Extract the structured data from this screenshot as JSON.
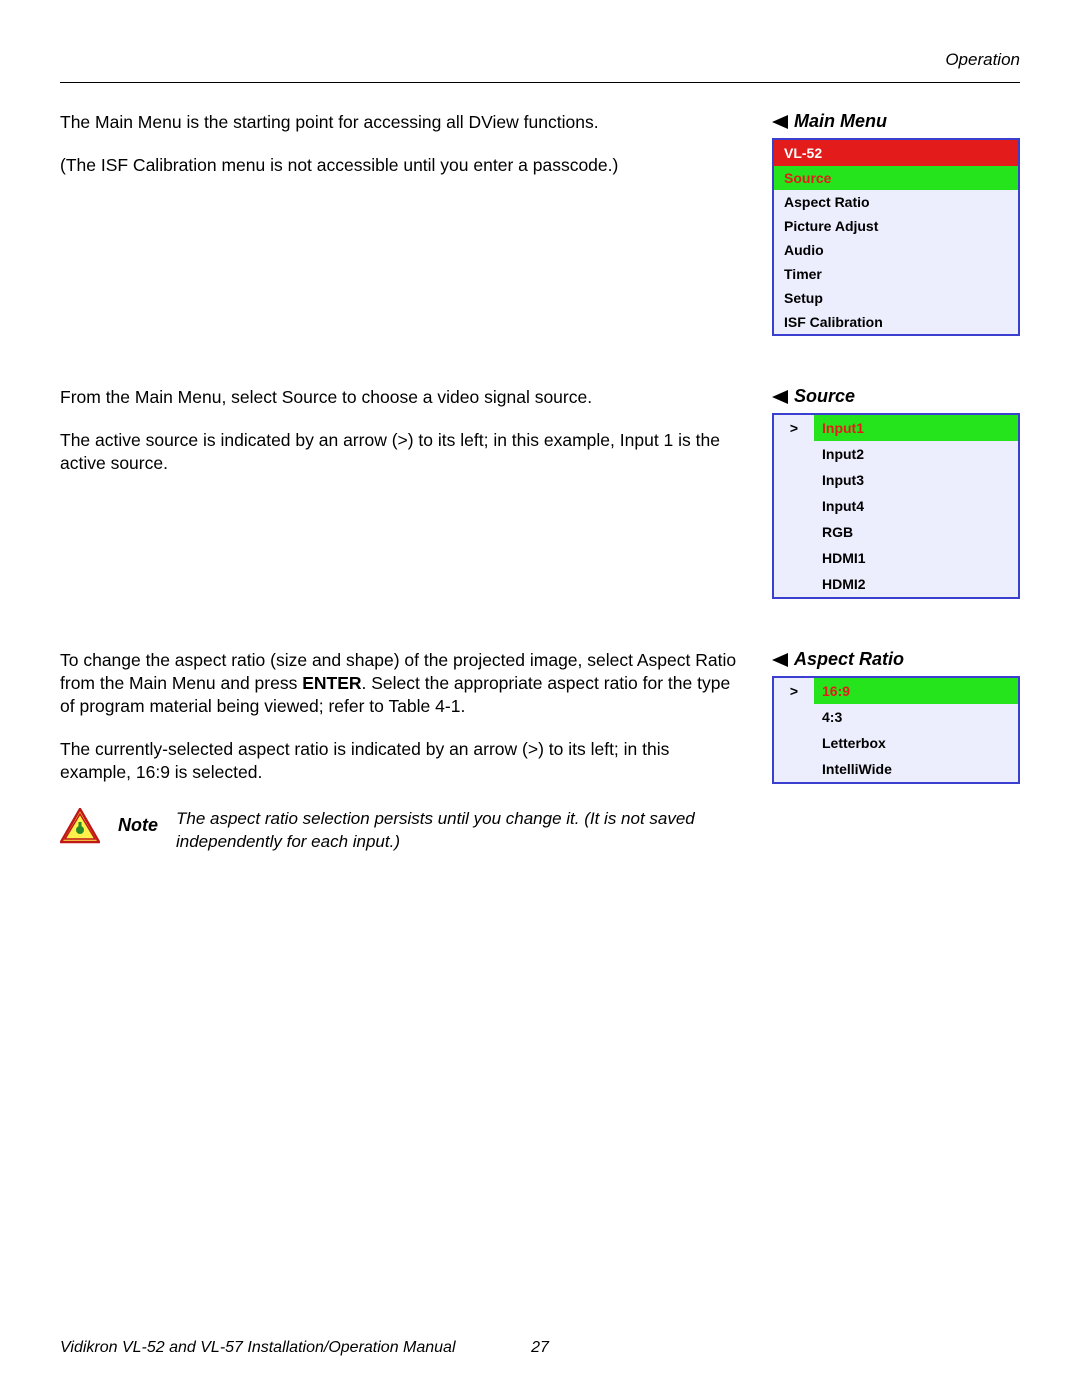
{
  "header": {
    "section_label": "Operation"
  },
  "main_menu_section": {
    "p1": "The Main Menu is the starting point for accessing all DView functions.",
    "p2": "(The ISF Calibration menu is not accessible until you enter a passcode.)",
    "heading": "Main Menu",
    "box_title": "VL-52",
    "items": [
      "Source",
      "Aspect Ratio",
      "Picture Adjust",
      "Audio",
      "Timer",
      "Setup",
      "ISF Calibration"
    ],
    "selected_index": 0
  },
  "source_section": {
    "p1": "From the Main Menu, select Source to choose a video signal source.",
    "p2": "The active source is indicated by an arrow (>) to its left; in this example, Input 1 is the active source.",
    "heading": "Source",
    "items": [
      "Input1",
      "Input2",
      "Input3",
      "Input4",
      "RGB",
      "HDMI1",
      "HDMI2"
    ],
    "selected_index": 0,
    "arrow_glyph": ">"
  },
  "aspect_section": {
    "p1_pre": "To change the aspect ratio (size and shape) of the projected image, select Aspect Ratio from the Main Menu and press ",
    "p1_bold": "ENTER",
    "p1_post": ". Select the appropriate aspect ratio for the type of program material being viewed; refer to Table 4-1.",
    "p2": "The currently-selected aspect ratio is indicated by an arrow (>) to its left; in this example, 16:9 is selected.",
    "heading": "Aspect Ratio",
    "items": [
      "16:9",
      "4:3",
      "Letterbox",
      "IntelliWide"
    ],
    "selected_index": 0,
    "arrow_glyph": ">"
  },
  "note": {
    "label": "Note",
    "text": "The aspect ratio selection persists until you change it. (It is not saved independently for each input.)"
  },
  "footer": {
    "manual_title": "Vidikron VL-52 and VL-57 Installation/Operation Manual",
    "page_num": "27"
  }
}
